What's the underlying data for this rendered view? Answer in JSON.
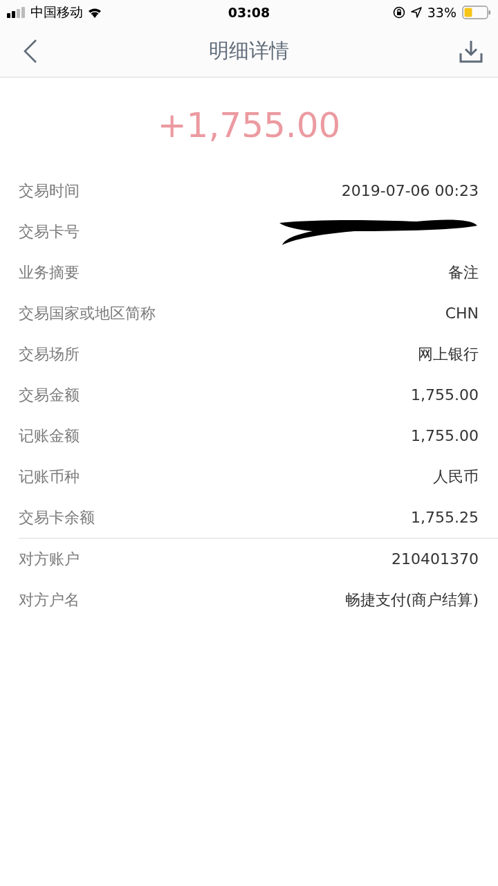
{
  "status_bar": {
    "carrier": "中国移动",
    "time": "03:08",
    "battery_percent": "33%"
  },
  "nav": {
    "title": "明细详情"
  },
  "amount": "+1,755.00",
  "details": [
    {
      "label": "交易时间",
      "value": "2019-07-06 00:23",
      "kind": "text"
    },
    {
      "label": "交易卡号",
      "kind": "redacted"
    },
    {
      "label": "业务摘要",
      "value": "备注",
      "kind": "text"
    },
    {
      "label": "交易国家或地区简称",
      "value": "CHN",
      "kind": "text"
    },
    {
      "label": "交易场所",
      "value": "网上银行",
      "kind": "text"
    },
    {
      "label": "交易金额",
      "value": "1,755.00",
      "kind": "text"
    },
    {
      "label": "记账金额",
      "value": "1,755.00",
      "kind": "text"
    },
    {
      "label": "记账币种",
      "value": "人民币",
      "kind": "text"
    },
    {
      "label": "交易卡余额",
      "value": "1,755.25",
      "kind": "text"
    }
  ],
  "counterparty": [
    {
      "label": "对方账户",
      "value": "210401370",
      "kind": "text"
    },
    {
      "label": "对方户名",
      "value": "畅捷支付(商户结算)",
      "kind": "text"
    }
  ]
}
